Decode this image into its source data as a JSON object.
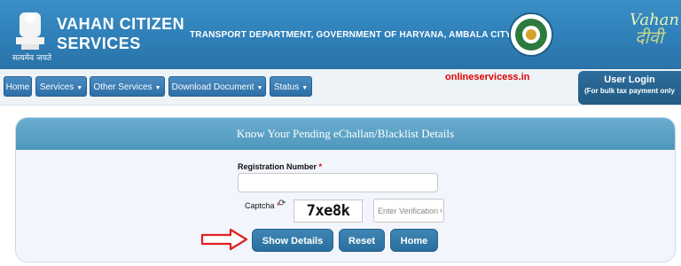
{
  "header": {
    "emblem_caption": "सत्यमेव जयते",
    "app_title_line1": "VAHAN CITIZEN",
    "app_title_line2": "SERVICES",
    "department": "TRANSPORT DEPARTMENT, GOVERNMENT OF HARYANA, AMBALA CITY",
    "logo_text_1": "Vahan",
    "logo_text_2": "दीवी"
  },
  "nav": {
    "items": [
      {
        "label": "Home",
        "dropdown": false
      },
      {
        "label": "Services",
        "dropdown": true
      },
      {
        "label": "Other Services",
        "dropdown": true
      },
      {
        "label": "Download Document",
        "dropdown": true
      },
      {
        "label": "Status",
        "dropdown": true
      }
    ],
    "promo": "onlineservicess.in",
    "user_login": {
      "line1": "User Login",
      "line2": "(For bulk tax payment only"
    }
  },
  "panel": {
    "title": "Know Your Pending eChallan/Blacklist Details",
    "registration_label": "Registration Number",
    "required_mark": "*",
    "registration_value": "",
    "captcha_label": "Captcha",
    "captcha_text": "7xe8k",
    "verification_placeholder": "Enter Verification C",
    "buttons": {
      "show_details": "Show Details",
      "reset": "Reset",
      "home": "Home"
    }
  },
  "colors": {
    "header_blue": "#2f7fb8",
    "nav_button": "#2c6fa6",
    "promo_red": "#e00000",
    "arrow_red": "#e02020"
  }
}
